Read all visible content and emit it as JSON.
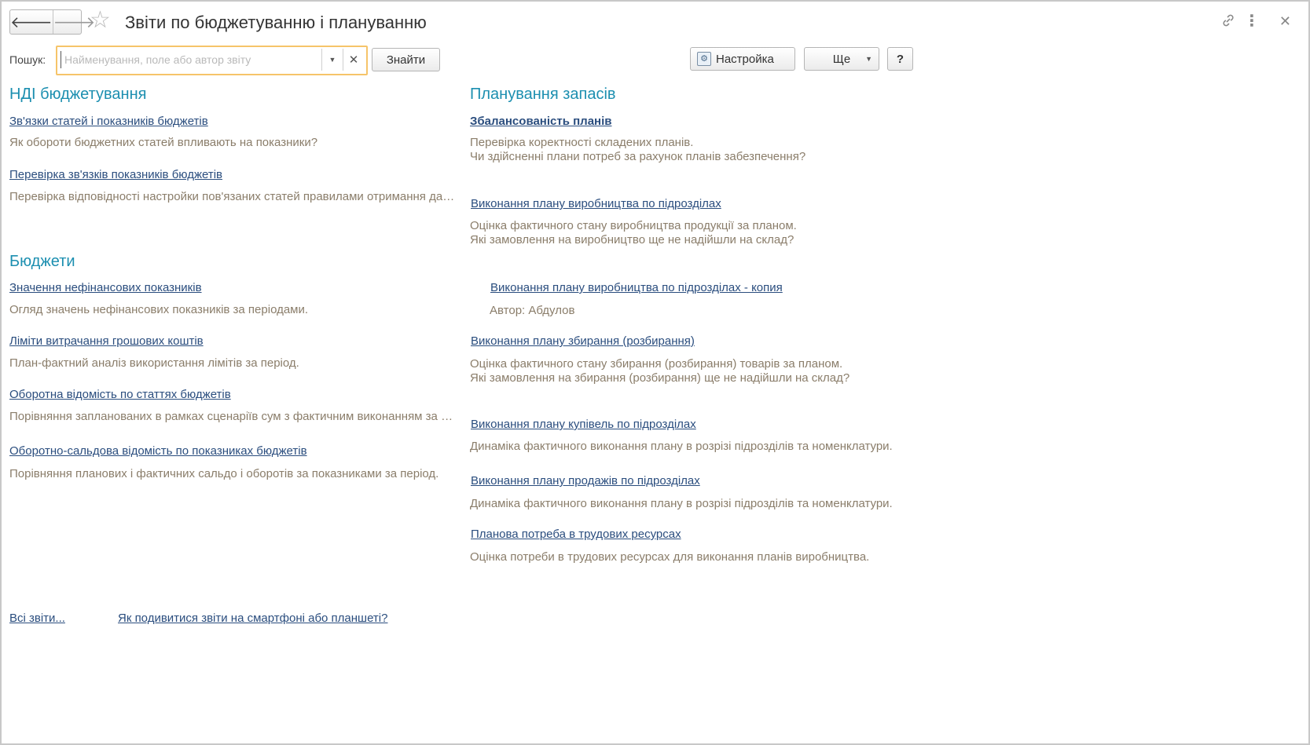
{
  "window": {
    "title": "Звіти по бюджетуванню і плануванню",
    "back_icon": "arrow-left-icon",
    "forward_icon": "arrow-right-icon",
    "favorite_icon": "star-icon",
    "link_icon": "link-icon",
    "more_icon": "more-vertical-icon",
    "close_icon": "close-icon"
  },
  "toolbar": {
    "search_label": "Пошук:",
    "search_placeholder": "Найменування, поле або автор звіту",
    "search_value": "",
    "find_label": "Знайти",
    "settings_label": "Настройка",
    "more_label": "Ще",
    "help_label": "?"
  },
  "left": {
    "ndi": {
      "heading": "НДІ бюджетування",
      "items": [
        {
          "link": "Зв'язки статей і показників бюджетів",
          "desc": "Як обороти бюджетних статей впливають на показники?"
        },
        {
          "link": "Перевірка зв'язків показників бюджетів",
          "desc": "Перевірка відповідності настройки пов'язаних статей правилами отримання даних"
        }
      ]
    },
    "budgets": {
      "heading": "Бюджети",
      "items": [
        {
          "link": "Значення нефінансових показників",
          "desc": "Огляд значень нефінансових показників за періодами."
        },
        {
          "link": "Ліміти витрачання грошових коштів",
          "desc": "План-фактний аналіз використання лімітів за період."
        },
        {
          "link": "Оборотна відомість по статтях бюджетів",
          "desc": "Порівняння запланованих в рамках сценаріїв сум з фактичним виконанням за період"
        },
        {
          "link": "Оборотно-сальдова відомість по показниках бюджетів",
          "desc": "Порівняння планових і фактичних сальдо і оборотів за показниками за період."
        }
      ]
    }
  },
  "right": {
    "heading": "Планування запасів",
    "items": [
      {
        "link": "Збалансованість планів",
        "desc1": "Перевірка коректності складених планів.",
        "desc2": "Чи здійсненні плани потреб за рахунок планів забезпечення?"
      },
      {
        "link": "Виконання плану виробництва по підрозділах",
        "desc1": "Оцінка фактичного стану виробництва продукції за планом.",
        "desc2": "Які замовлення на виробництво ще не надійшли на склад?"
      },
      {
        "link": "Виконання плану виробництва по підрозділах - копия",
        "desc1": "Автор: Абдулов"
      },
      {
        "link": "Виконання плану збирання (розбирання)",
        "desc1": "Оцінка фактичного стану збирання (розбирання) товарів за планом.",
        "desc2": "Які замовлення на збирання (розбирання) ще не надійшли на склад?"
      },
      {
        "link": "Виконання плану купівель по підрозділах",
        "desc1": "Динаміка фактичного виконання плану в розрізі підрозділів та номенклатури."
      },
      {
        "link": "Виконання плану продажів по підрозділах",
        "desc1": "Динаміка фактичного виконання плану в розрізі підрозділів та номенклатури."
      },
      {
        "link": "Планова потреба в трудових ресурсах",
        "desc1": "Оцінка потреби в трудових ресурсах для виконання планів виробництва."
      }
    ]
  },
  "footer": {
    "all_reports": "Всі звіти...",
    "mobile_help": "Як подивитися звіти на смартфоні або планшеті?"
  }
}
